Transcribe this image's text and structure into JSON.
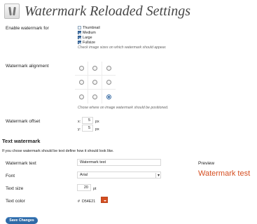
{
  "page": {
    "title": "Watermark Reloaded Settings"
  },
  "enable": {
    "label": "Enable watermark for",
    "options": [
      {
        "label": "Thumbnail",
        "checked": false
      },
      {
        "label": "Medium",
        "checked": true
      },
      {
        "label": "Large",
        "checked": true
      },
      {
        "label": "Fullsize",
        "checked": true
      }
    ],
    "hint": "Check image sizes on which watermark should appear."
  },
  "alignment": {
    "label": "Watermark alignment",
    "selected": "bottom-right",
    "hint": "Chose where on image watermark should be positioned."
  },
  "offset": {
    "label": "Watermark offset",
    "x_label": "x:",
    "x_value": "5",
    "y_label": "y:",
    "y_value": "5",
    "unit": "px"
  },
  "text_section": {
    "heading": "Text watermark",
    "description": "If you chose watermark should be text define how it should look like.",
    "text_label": "Watermark text",
    "text_value": "Watermark test",
    "preview_label": "Preview",
    "preview_text": "Watermark test",
    "font_label": "Font",
    "font_value": "Arial",
    "size_label": "Text size",
    "size_value": "20",
    "size_unit": "pt",
    "color_label": "Text color",
    "color_hash": "#",
    "color_value": "D54E21"
  },
  "actions": {
    "save_label": "Save Changes"
  },
  "colors": {
    "accent": "#D54E21",
    "button": "#2E6AA7"
  },
  "icons": {
    "settings": "settings-icon",
    "dropdown": "chevron-down-icon",
    "color_picker": "color-picker-icon"
  }
}
